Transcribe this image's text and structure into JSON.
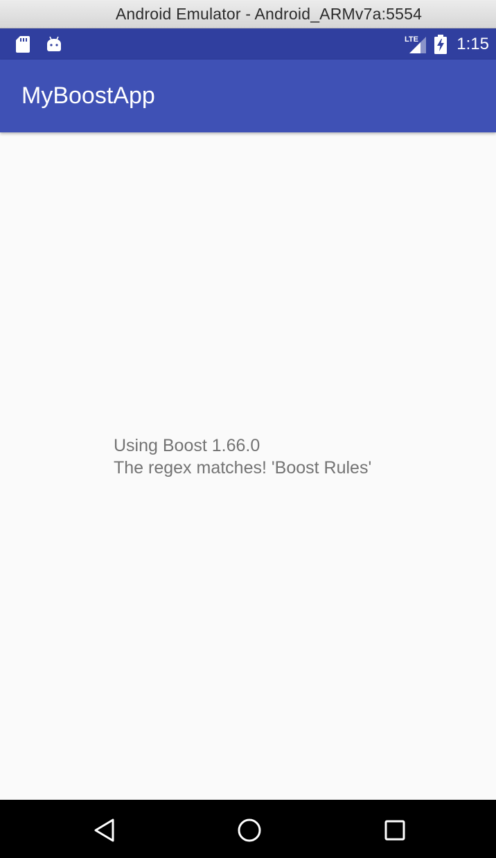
{
  "window": {
    "title": "Android Emulator - Android_ARMv7a:5554"
  },
  "status_bar": {
    "network_type": "LTE",
    "time": "1:15",
    "icons_left": [
      "sd-card-icon",
      "android-icon"
    ],
    "icons_right": [
      "signal-lte-icon",
      "battery-charging-icon"
    ]
  },
  "app_bar": {
    "title": "MyBoostApp"
  },
  "main": {
    "lines": [
      "Using Boost 1.66.0",
      "The regex matches! 'Boost Rules'"
    ]
  },
  "nav_bar": {
    "buttons": [
      "back-icon",
      "home-icon",
      "recents-icon"
    ]
  },
  "colors": {
    "primary": "#3f51b5",
    "primary_dark": "#303f9f",
    "background": "#fafafa",
    "text_secondary": "#737373"
  }
}
